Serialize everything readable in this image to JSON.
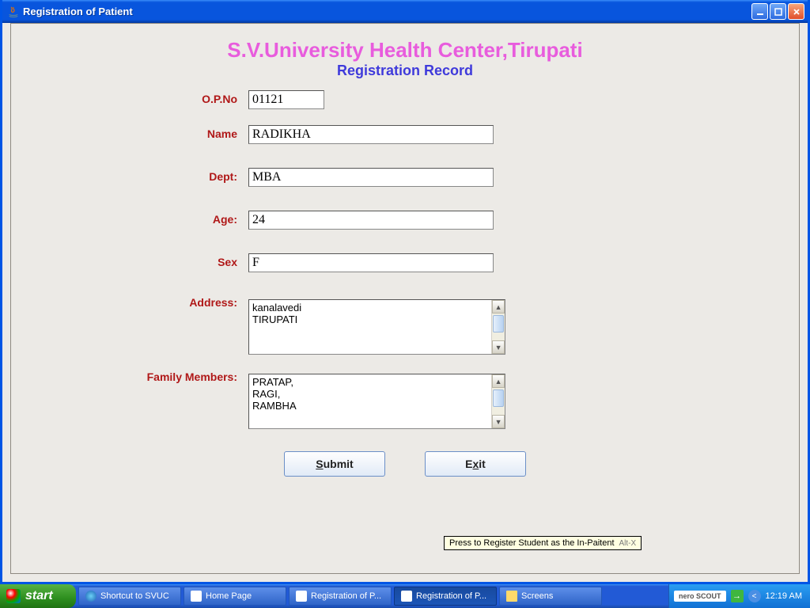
{
  "window": {
    "title": "Registration of Patient"
  },
  "header": {
    "title": "S.V.University Health Center,Tirupati",
    "subtitle": "Registration Record"
  },
  "labels": {
    "opno": "O.P.No",
    "name": "Name",
    "dept": "Dept:",
    "age": "Age:",
    "sex": "Sex",
    "address": "Address:",
    "family": "Family Members:"
  },
  "values": {
    "opno": "01121",
    "name": "RADIKHA",
    "dept": "MBA",
    "age": "24",
    "sex": "F",
    "address": "kanalavedi\nTIRUPATI",
    "family": "PRATAP,\nRAGI,\nRAMBHA"
  },
  "buttons": {
    "submit": "Submit",
    "exit": "Exit"
  },
  "tooltip": {
    "text": "Press to Register Student as the In-Paitent",
    "accel": "Alt-X"
  },
  "taskbar": {
    "start": "start",
    "items": [
      "Shortcut to SVUC",
      "Home Page",
      "Registration of P...",
      "Registration of P...",
      "Screens"
    ],
    "tray_pill": "nero SCOUT",
    "clock": "12:19 AM"
  }
}
